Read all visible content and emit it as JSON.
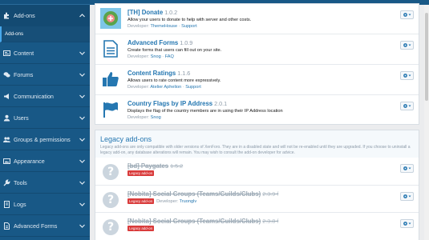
{
  "sidebar": {
    "items": [
      {
        "label": "Add-ons",
        "icon": "puzzle-icon",
        "active": true
      },
      {
        "label": "Content",
        "icon": "content-icon"
      },
      {
        "label": "Forums",
        "icon": "forums-icon"
      },
      {
        "label": "Communication",
        "icon": "megaphone-icon"
      },
      {
        "label": "Users",
        "icon": "user-icon"
      },
      {
        "label": "Groups & permissions",
        "icon": "groups-icon"
      },
      {
        "label": "Appearance",
        "icon": "image-icon"
      },
      {
        "label": "Tools",
        "icon": "wrench-icon"
      },
      {
        "label": "Logs",
        "icon": "logs-icon"
      },
      {
        "label": "Advanced Forms",
        "icon": "form-icon"
      }
    ],
    "sub_item": "Add-ons"
  },
  "addons": [
    {
      "title": "[TH] Donate",
      "version": "1.0.2",
      "description": "Allow your users to donate to help with server and other costs.",
      "developer_label": "Developer:",
      "developer": "ThemeHouse",
      "link": "Support"
    },
    {
      "title": "Advanced Forms",
      "version": "1.0.9",
      "description": "Create forms that users can fill out on your site.",
      "developer_label": "Developer:",
      "developer": "Snog",
      "link": "FAQ"
    },
    {
      "title": "Content Ratings",
      "version": "1.1.6",
      "description": "Allows users to rate content more expressively.",
      "developer_label": "Developer:",
      "developer": "Atelier Aphelion",
      "link": "Support"
    },
    {
      "title": "Country Flags by IP Address",
      "version": "2.0.1",
      "description": "Displays the flag of the country members are in using their IP Address location",
      "developer_label": "Developer:",
      "developer": "Snog"
    }
  ],
  "legacy": {
    "heading": "Legacy add-ons",
    "note": "Legacy add-ons are only compatible with older versions of XenForo. They are in a disabled state and will not be re-enabled until they are upgraded. If you choose to uninstall a legacy add-on, any database alterations will remain. You may wish to consult the add-on developer for advice.",
    "badge": "Legacy add-on",
    "items": [
      {
        "title": "[bd] Paygates",
        "version": "1.5.2"
      },
      {
        "title": "[Nobita] Social Groups (Teams/Guilds/Clubs)",
        "version": "2.3.9 f",
        "developer_label": "Developer:",
        "developer": "Truonglv"
      },
      {
        "title": "[Nobita] Social Groups (Teams/Guilds/Clubs)",
        "version": "2.3.8 f"
      }
    ]
  },
  "colors": {
    "sidebar": "#185886",
    "link": "#2577b1",
    "legacy_badge": "#d93b3b"
  }
}
